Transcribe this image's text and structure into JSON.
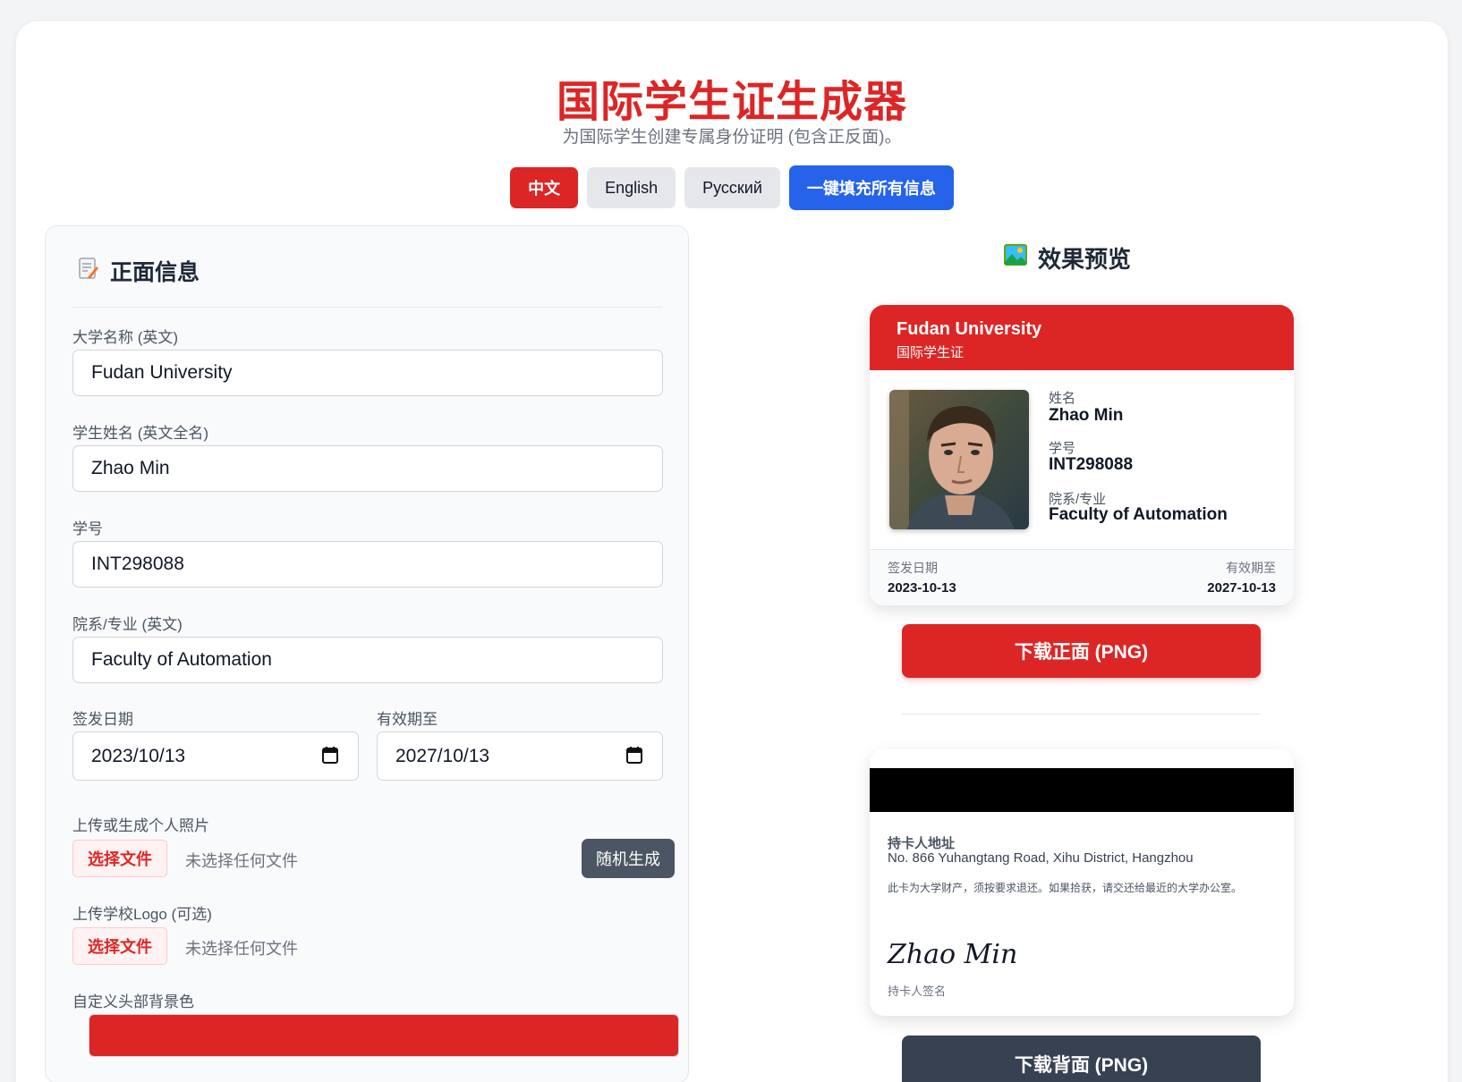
{
  "header": {
    "title": "国际学生证生成器",
    "subtitle": "为国际学生创建专属身份证明 (包含正反面)。"
  },
  "toolbar": {
    "lang_zh": "中文",
    "lang_en": "English",
    "lang_ru": "Русский",
    "fill_all": "一键填充所有信息"
  },
  "form": {
    "heading": "正面信息",
    "heading_icon": "memo-icon",
    "university_label": "大学名称 (英文)",
    "university_value": "Fudan University",
    "name_label": "学生姓名 (英文全名)",
    "name_value": "Zhao Min",
    "id_label": "学号",
    "id_value": "INT298088",
    "dept_label": "院系/专业 (英文)",
    "dept_value": "Faculty of Automation",
    "issue_label": "签发日期",
    "issue_value": "2023/10/13",
    "expiry_label": "有效期至",
    "expiry_value": "2027/10/13",
    "photo_label": "上传或生成个人照片",
    "choose_file": "选择文件",
    "no_file": "未选择任何文件",
    "random_button": "随机生成",
    "logo_label": "上传学校Logo (可选)",
    "logo_choose": "选择文件",
    "logo_no_file": "未选择任何文件",
    "color_label": "自定义头部背景色",
    "header_color": "#dc2626"
  },
  "preview": {
    "title": "效果预览",
    "title_icon": "picture-icon",
    "front": {
      "university": "Fudan University",
      "card_type": "国际学生证",
      "name_key": "姓名",
      "name": "Zhao Min",
      "id_key": "学号",
      "id": "INT298088",
      "dept_key": "院系/专业",
      "dept": "Faculty of Automation",
      "issue_key": "签发日期",
      "issue": "2023-10-13",
      "expiry_key": "有效期至",
      "expiry": "2027-10-13"
    },
    "download_front": "下载正面 (PNG)",
    "back": {
      "address_key": "持卡人地址",
      "address": "No. 866 Yuhangtang Road, Xihu District, Hangzhou",
      "note": "此卡为大学财产，须按要求退还。如果拾获，请交还给最近的大学办公室。",
      "signature": "Zhao Min",
      "signature_key": "持卡人签名"
    },
    "download_back": "下载背面 (PNG)"
  }
}
